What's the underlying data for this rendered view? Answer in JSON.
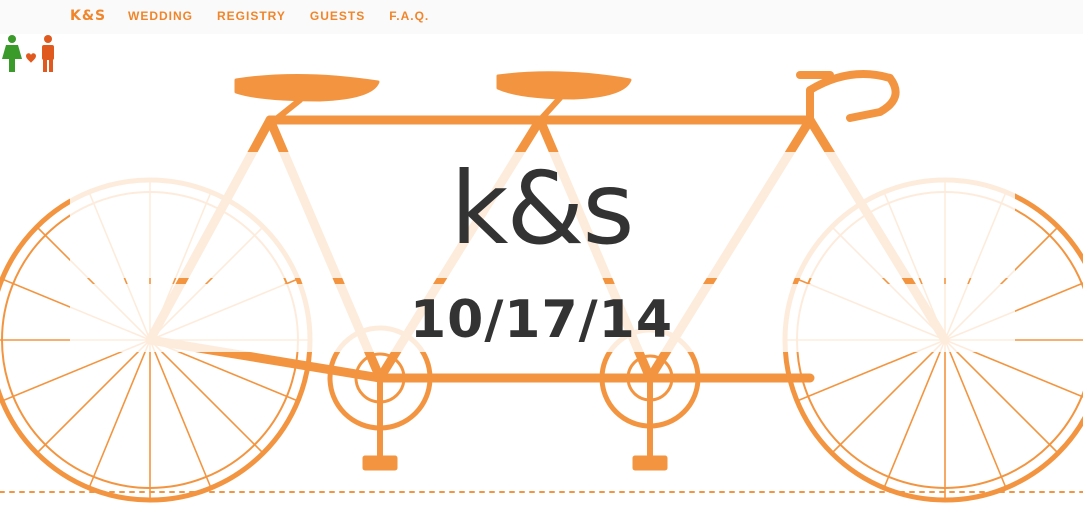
{
  "nav": {
    "brand": "K&S",
    "items": [
      {
        "label": "WEDDING"
      },
      {
        "label": "REGISTRY"
      },
      {
        "label": "GUESTS"
      },
      {
        "label": "F.A.Q."
      }
    ]
  },
  "hero": {
    "title": "k&s",
    "date": "10/17/14",
    "image": "tandem-bicycle-illustration",
    "accent_color": "#f0852a"
  },
  "couple_icon": "bride-groom-heart-icon"
}
